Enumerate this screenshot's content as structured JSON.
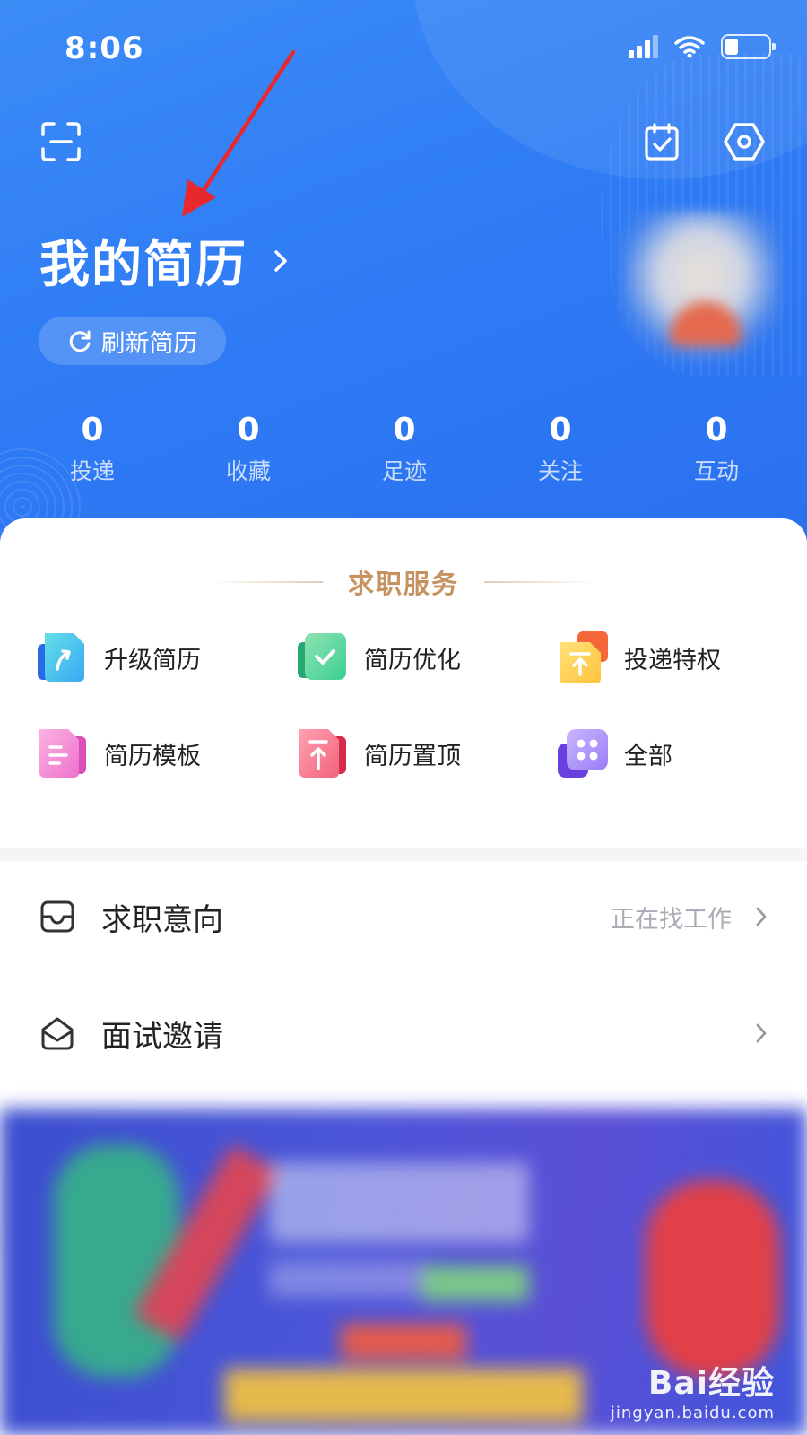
{
  "status_bar": {
    "time": "8:06"
  },
  "header": {
    "title": "我的简历",
    "refresh_label": "刷新简历"
  },
  "stats": [
    {
      "value": "0",
      "label": "投递"
    },
    {
      "value": "0",
      "label": "收藏"
    },
    {
      "value": "0",
      "label": "足迹"
    },
    {
      "value": "0",
      "label": "关注"
    },
    {
      "value": "0",
      "label": "互动"
    }
  ],
  "services": {
    "title": "求职服务",
    "items": [
      {
        "label": "升级简历",
        "icon": "upgrade-resume-icon"
      },
      {
        "label": "简历优化",
        "icon": "resume-optimize-icon"
      },
      {
        "label": "投递特权",
        "icon": "delivery-privilege-icon"
      },
      {
        "label": "简历模板",
        "icon": "resume-template-icon"
      },
      {
        "label": "简历置顶",
        "icon": "resume-top-icon"
      },
      {
        "label": "全部",
        "icon": "all-services-icon"
      }
    ]
  },
  "list": [
    {
      "label": "求职意向",
      "value": "正在找工作",
      "icon": "job-intention-icon"
    },
    {
      "label": "面试邀请",
      "value": "",
      "icon": "interview-invite-icon"
    }
  ],
  "watermark": {
    "main": "Bai经验",
    "sub": "jingyan.baidu.com"
  },
  "colors": {
    "hero_blue": "#2f7cf5",
    "section_gold": "#c59260",
    "arrow_red": "#e8282b"
  }
}
